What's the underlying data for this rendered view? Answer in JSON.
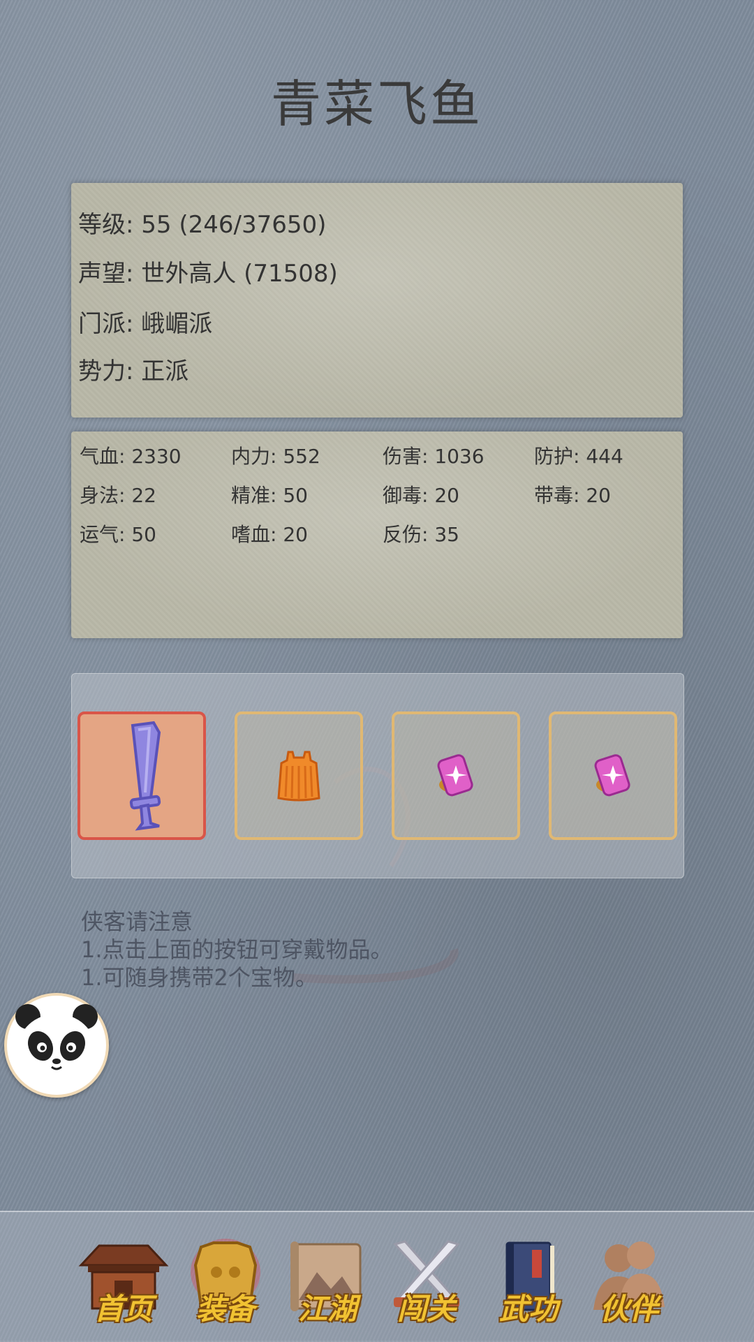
{
  "title": "青菜飞鱼",
  "profile": {
    "level_label": "等级:",
    "level_value": "55 (246/37650)",
    "fame_label": "声望:",
    "fame_value": "世外高人 (71508)",
    "sect_label": "门派:",
    "sect_value": "峨嵋派",
    "faction_label": "势力:",
    "faction_value": "正派"
  },
  "stats": [
    {
      "label": "气血:",
      "value": "2330"
    },
    {
      "label": "内力:",
      "value": "552"
    },
    {
      "label": "伤害:",
      "value": "1036"
    },
    {
      "label": "防护:",
      "value": "444"
    },
    {
      "label": "身法:",
      "value": "22"
    },
    {
      "label": "精准:",
      "value": "50"
    },
    {
      "label": "御毒:",
      "value": "20"
    },
    {
      "label": "带毒:",
      "value": "20"
    },
    {
      "label": "运气:",
      "value": "50"
    },
    {
      "label": "嗜血:",
      "value": "20"
    },
    {
      "label": "反伤:",
      "value": "35"
    }
  ],
  "equipment": [
    {
      "icon": "sword-icon",
      "selected": true
    },
    {
      "icon": "armor-icon",
      "selected": false
    },
    {
      "icon": "treasure-icon",
      "selected": false
    },
    {
      "icon": "treasure-icon",
      "selected": false
    }
  ],
  "notice": {
    "heading": "侠客请注意",
    "line1": "1.点击上面的按钮可穿戴物品。",
    "line2": "1.可随身携带2个宝物。"
  },
  "nav": [
    {
      "label": "首页",
      "icon": "house-icon"
    },
    {
      "label": "装备",
      "icon": "armor-icon"
    },
    {
      "label": "江湖",
      "icon": "scroll-map-icon"
    },
    {
      "label": "闯关",
      "icon": "crossed-swords-icon"
    },
    {
      "label": "武功",
      "icon": "book-icon"
    },
    {
      "label": "伙伴",
      "icon": "partners-icon"
    }
  ],
  "colors": {
    "background": "#7f8c9c",
    "panel": "#b9b8a8",
    "slot_border": "#e0b873",
    "slot_active_border": "#d95548",
    "nav_label": "#f1c232"
  }
}
